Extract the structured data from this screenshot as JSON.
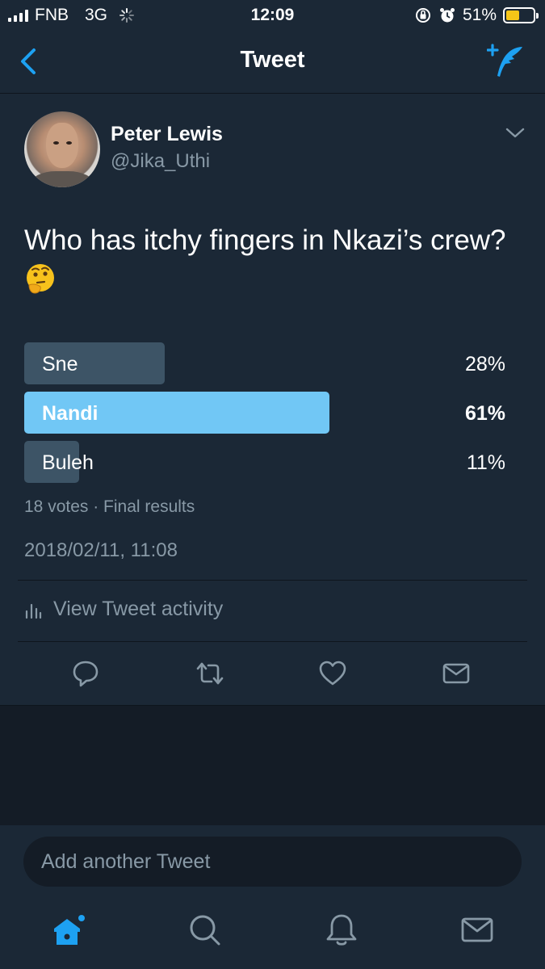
{
  "status_bar": {
    "carrier": "FNB",
    "network": "3G",
    "time": "12:09",
    "battery_percent": "51%",
    "battery_level": 0.51,
    "battery_color": "#f5c518"
  },
  "nav": {
    "title": "Tweet",
    "back_icon": "chevron-left-icon",
    "compose_icon": "compose-tweet-icon"
  },
  "tweet": {
    "author_name": "Peter Lewis",
    "author_handle": "@Jika_Uthi",
    "text": "Who has itchy fingers in Nkazi’s crew?",
    "emoji": "thinking-face-emoji",
    "poll": {
      "options": [
        {
          "label": "Sne",
          "percent": "28%",
          "fraction": 0.28,
          "winner": false
        },
        {
          "label": "Nandi",
          "percent": "61%",
          "fraction": 0.61,
          "winner": true
        },
        {
          "label": "Buleh",
          "percent": "11%",
          "fraction": 0.11,
          "winner": false
        }
      ],
      "summary": "18 votes · Final results"
    },
    "timestamp": "2018/02/11, 11:08",
    "activity_label": "View Tweet activity"
  },
  "actions": [
    "reply-icon",
    "retweet-icon",
    "like-icon",
    "direct-message-icon"
  ],
  "reply_box": {
    "placeholder": "Add another Tweet"
  },
  "tab_bar": [
    "home-icon",
    "search-icon",
    "notifications-icon",
    "messages-icon"
  ],
  "colors": {
    "accent": "#1da1f2",
    "poll_winner": "#71c7f5",
    "poll_other": "#3d5466",
    "background": "#141c26",
    "card": "#1b2836",
    "secondary_text": "#8899a6"
  }
}
